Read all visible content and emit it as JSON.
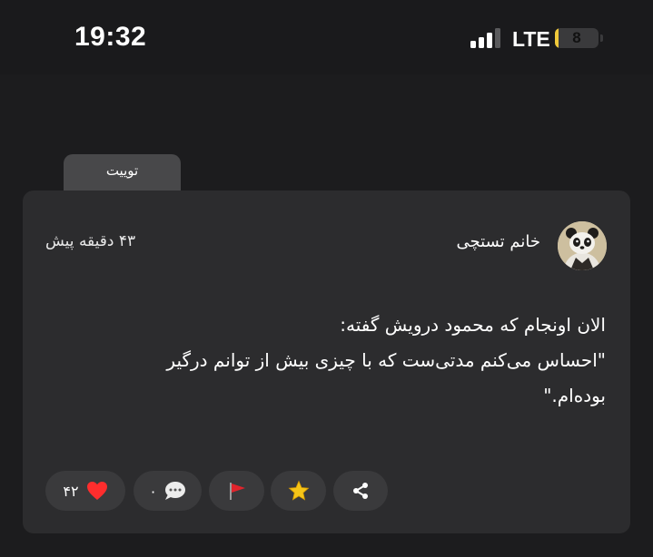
{
  "status_bar": {
    "time": "19:32",
    "network": "LTE",
    "battery_level": "8",
    "battery_fraction": 0.08,
    "battery_color": "#f0c93a",
    "signal_bars_filled": 3,
    "signal_bars_total": 4
  },
  "tab": {
    "label": "توییت"
  },
  "post": {
    "author": "خانم تستچی",
    "time_ago": "۴۳ دقیقه پیش",
    "avatar_icon": "panda-avatar",
    "text_lines": [
      "الان اونجام که محمود درویش گفته:",
      "\"احساس می‌کنم مدتی‌ست که با چیزی بیش از توانم درگیر",
      "بوده‌ام.\""
    ]
  },
  "actions": {
    "likes": {
      "count": "۴۲",
      "icon": "heart-icon",
      "color": "#ff2d2d"
    },
    "comments": {
      "count": "۰",
      "icon": "speech-bubble-icon"
    },
    "report": {
      "icon": "red-flag-icon",
      "color": "#e0242c"
    },
    "favorite": {
      "icon": "star-icon",
      "color": "#f5c518"
    },
    "share": {
      "icon": "share-icon"
    }
  }
}
